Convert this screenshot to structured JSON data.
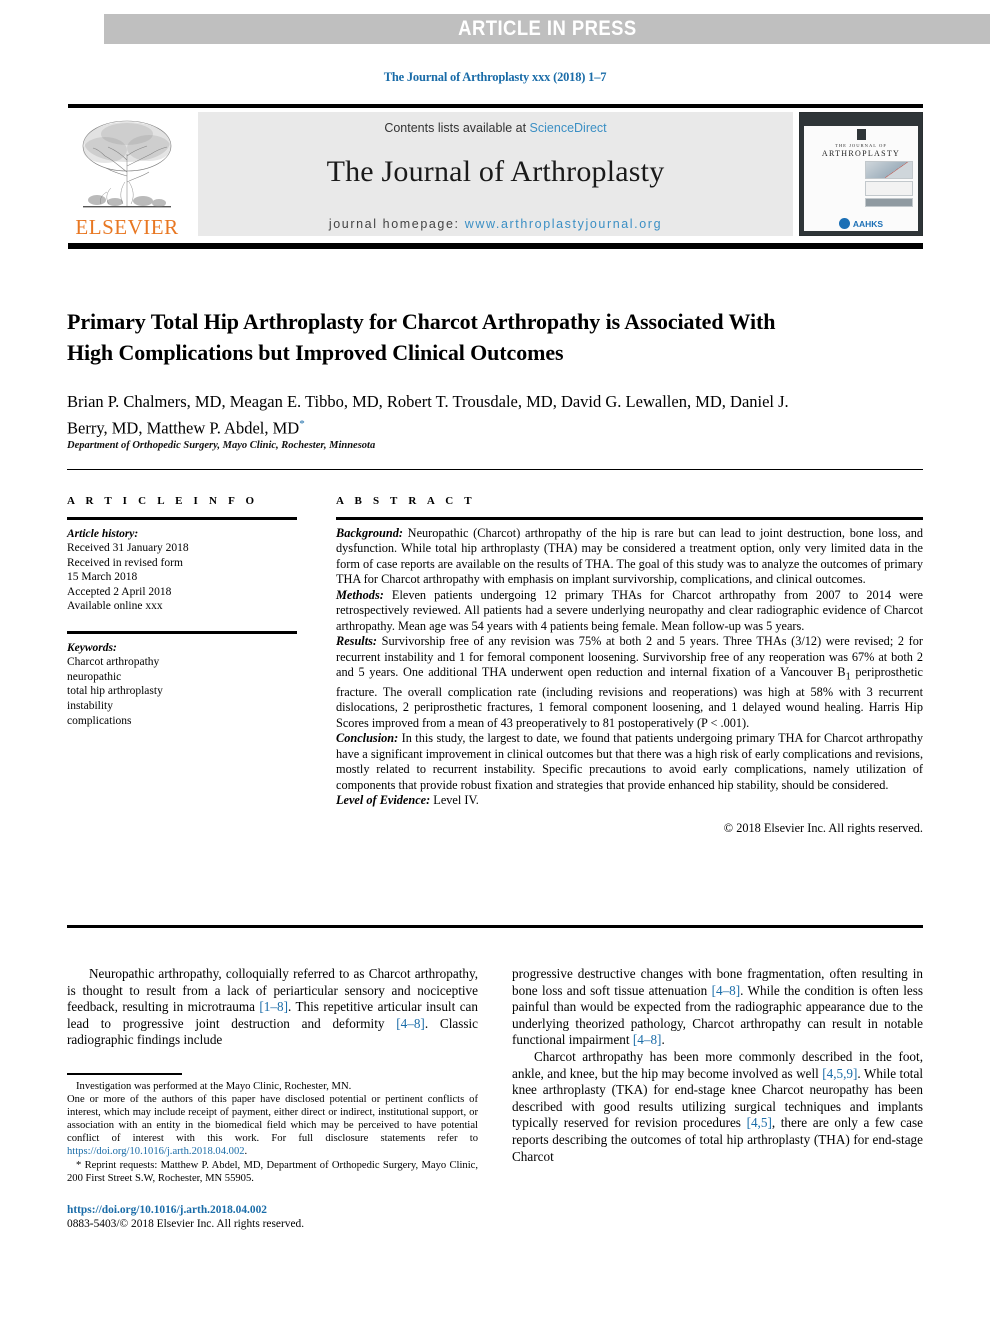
{
  "banner": {
    "text": "ARTICLE IN PRESS"
  },
  "running_head": "The Journal of Arthroplasty xxx (2018) 1–7",
  "masthead": {
    "publisher_name": "ELSEVIER",
    "contents_prefix": "Contents lists available at ",
    "contents_link": "ScienceDirect",
    "journal_title": "The Journal of Arthroplasty",
    "homepage_prefix": "journal homepage: ",
    "homepage_link": "www.arthroplastyjournal.org",
    "cover": {
      "line1": "THE JOURNAL OF",
      "line2": "ARTHROPLASTY",
      "society": "AAHKS"
    }
  },
  "article": {
    "title": "Primary Total Hip Arthroplasty for Charcot Arthropathy is Associated With High Complications but Improved Clinical Outcomes",
    "authors": "Brian P. Chalmers, MD, Meagan E. Tibbo, MD, Robert T. Trousdale, MD, David G. Lewallen, MD, Daniel J. Berry, MD, Matthew P. Abdel, MD",
    "corresponding_marker": "*",
    "affiliation": "Department of Orthopedic Surgery, Mayo Clinic, Rochester, Minnesota"
  },
  "article_info": {
    "heading": "A R T I C L E   I N F O",
    "history_label": "Article history:",
    "history_lines": [
      "Received 31 January 2018",
      "Received in revised form",
      "15 March 2018",
      "Accepted 2 April 2018",
      "Available online xxx"
    ],
    "keywords_label": "Keywords:",
    "keywords": [
      "Charcot arthropathy",
      "neuropathic",
      "total hip arthroplasty",
      "instability",
      "complications"
    ]
  },
  "abstract": {
    "heading": "A B S T R A C T",
    "background_label": "Background:",
    "background_text": " Neuropathic (Charcot) arthropathy of the hip is rare but can lead to joint destruction, bone loss, and dysfunction. While total hip arthroplasty (THA) may be considered a treatment option, only very limited data in the form of case reports are available on the results of THA. The goal of this study was to analyze the outcomes of primary THA for Charcot arthropathy with emphasis on implant survivorship, complications, and clinical outcomes.",
    "methods_label": "Methods:",
    "methods_text": " Eleven patients undergoing 12 primary THAs for Charcot arthropathy from 2007 to 2014 were retrospectively reviewed. All patients had a severe underlying neuropathy and clear radiographic evidence of Charcot arthropathy. Mean age was 54 years with 4 patients being female. Mean follow-up was 5 years.",
    "results_label": "Results:",
    "results_text": " Survivorship free of any revision was 75% at both 2 and 5 years. Three THAs (3/12) were revised; 2 for recurrent instability and 1 for femoral component loosening. Survivorship free of any reoperation was 67% at both 2 and 5 years. One additional THA underwent open reduction and internal fixation of a Vancouver B1 periprosthetic fracture. The overall complication rate (including revisions and reoperations) was high at 58% with 3 recurrent dislocations, 2 periprosthetic fractures, 1 femoral component loosening, and 1 delayed wound healing. Harris Hip Scores improved from a mean of 43 preoperatively to 81 postoperatively (P < .001).",
    "conclusion_label": "Conclusion:",
    "conclusion_text": " In this study, the largest to date, we found that patients undergoing primary THA for Charcot arthropathy have a significant improvement in clinical outcomes but that there was a high risk of early complications and revisions, mostly related to recurrent instability. Specific precautions to avoid early complications, namely utilization of components that provide robust fixation and strategies that provide enhanced hip stability, should be considered.",
    "evidence_label": "Level of Evidence:",
    "evidence_text": " Level IV.",
    "copyright": "© 2018 Elsevier Inc. All rights reserved."
  },
  "body": {
    "left_paragraph": "Neuropathic arthropathy, colloquially referred to as Charcot arthropathy, is thought to result from a lack of periarticular sensory and nociceptive feedback, resulting in microtrauma [1–8]. This repetitive articular insult can lead to progressive joint destruction and deformity [4–8]. Classic radiographic findings include",
    "right_paragraph_1": "progressive destructive changes with bone fragmentation, often resulting in bone loss and soft tissue attenuation [4–8]. While the condition is often less painful than would be expected from the radiographic appearance due to the underlying theorized pathology, Charcot arthropathy can result in notable functional impairment [4–8].",
    "right_paragraph_2": "Charcot arthropathy has been more commonly described in the foot, ankle, and knee, but the hip may become involved as well [4,5,9]. While total knee arthroplasty (TKA) for end-stage knee Charcot neuropathy has been described with good results utilizing surgical techniques and implants typically reserved for revision procedures [4,5], there are only a few case reports describing the outcomes of total hip arthroplasty (THA) for end-stage Charcot"
  },
  "footnotes": {
    "investigation": "Investigation was performed at the Mayo Clinic, Rochester, MN.",
    "disclosure_text": "One or more of the authors of this paper have disclosed potential or pertinent conflicts of interest, which may include receipt of payment, either direct or indirect, institutional support, or association with an entity in the biomedical field which may be perceived to have potential conflict of interest with this work. For full disclosure statements refer to ",
    "disclosure_link": "https://doi.org/10.1016/j.arth.2018.04.002",
    "disclosure_end": ".",
    "reprint_marker": "*",
    "reprint_text": " Reprint requests: Matthew P. Abdel, MD, Department of Orthopedic Surgery, Mayo Clinic, 200 First Street S.W, Rochester, MN 55905.",
    "doi": "https://doi.org/10.1016/j.arth.2018.04.002",
    "issn": "0883-5403/© 2018 Elsevier Inc. All rights reserved."
  },
  "colors": {
    "link": "#1a6ca8",
    "sciencedirect": "#3b8fc4",
    "elsevier_orange": "#e87722",
    "banner_gray": "#bfbfbf",
    "masthead_gray": "#e9e9e9"
  }
}
